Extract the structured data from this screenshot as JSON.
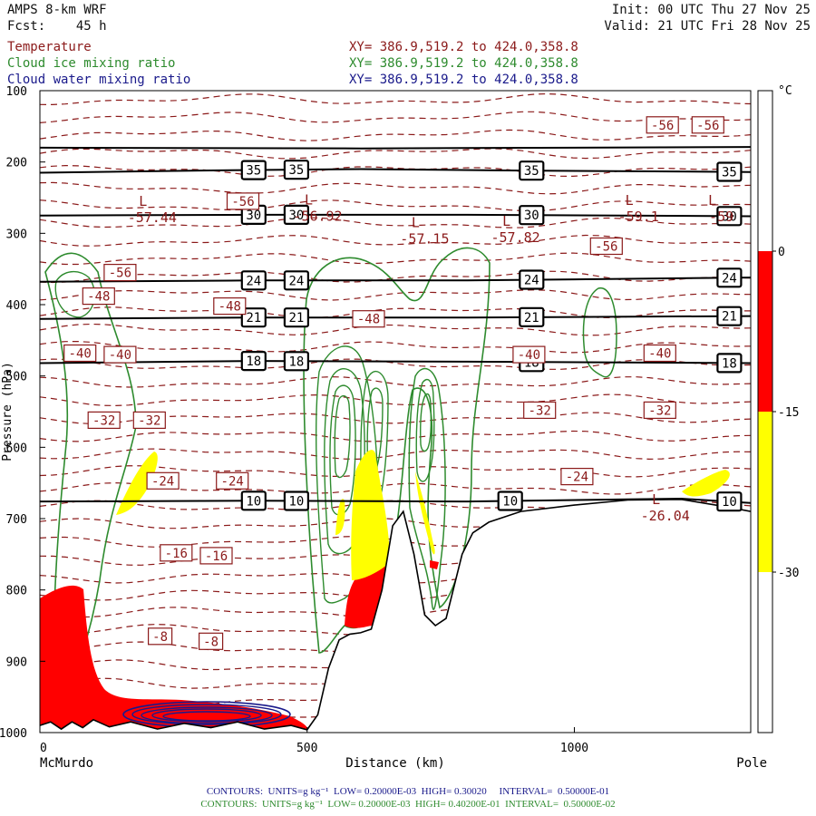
{
  "header": {
    "title": "AMPS 8-km WRF",
    "fcst_label": "Fcst:",
    "fcst_value": "45 h",
    "init": "Init: 00 UTC Thu 27 Nov 25",
    "valid": "Valid: 21 UTC Fri 28 Nov 25"
  },
  "fields": [
    {
      "name": "Temperature",
      "xy": "XY= 386.9,519.2 to 424.0,358.8",
      "color": "#8b1a1a"
    },
    {
      "name": "Cloud ice mixing ratio",
      "xy": "XY= 386.9,519.2 to 424.0,358.8",
      "color": "#2e8b2e"
    },
    {
      "name": "Cloud water mixing ratio",
      "xy": "XY= 386.9,519.2 to 424.0,358.8",
      "color": "#1a1a8b"
    }
  ],
  "footer": {
    "line1": "CONTOURS:  UNITS=g kg⁻¹  LOW= 0.20000E-03  HIGH= 0.30020     INTERVAL=  0.50000E-01",
    "line2": "CONTOURS:  UNITS=g kg⁻¹  LOW= 0.20000E-03  HIGH= 0.40200E-01  INTERVAL=  0.50000E-02",
    "line1_color": "#1a1a8b",
    "line2_color": "#2e8b2e"
  },
  "chart_data": {
    "type": "cross-section contour",
    "xlabel": "Distance (km)",
    "ylabel": "Pressure (hPa)",
    "xlim": [
      0,
      1330
    ],
    "ylim": [
      1000,
      100
    ],
    "x_ticks": [
      0,
      500,
      1000
    ],
    "x_end_labels": {
      "left": "McMurdo",
      "right": "Pole"
    },
    "y_ticks": [
      100,
      200,
      300,
      400,
      500,
      600,
      700,
      800,
      900,
      1000
    ],
    "colorbar": {
      "unit": "°C",
      "ticks": [
        0,
        -15,
        -30
      ],
      "bands": [
        {
          "from": 0,
          "to": -15,
          "color": "#ff0000"
        },
        {
          "from": -15,
          "to": -30,
          "color": "#ffff00"
        }
      ]
    },
    "isentropes": [
      {
        "label": "35",
        "points": [
          [
            0,
            215
          ],
          [
            300,
            212
          ],
          [
            600,
            210
          ],
          [
            900,
            212
          ],
          [
            1330,
            214
          ]
        ],
        "labels_at": [
          400,
          480,
          920,
          1290
        ]
      },
      {
        "label": "30",
        "points": [
          [
            0,
            275
          ],
          [
            400,
            274
          ],
          [
            800,
            274
          ],
          [
            1330,
            276
          ]
        ],
        "labels_at": [
          400,
          480,
          920,
          1290
        ]
      },
      {
        "label": "24",
        "points": [
          [
            0,
            368
          ],
          [
            400,
            366
          ],
          [
            800,
            366
          ],
          [
            1330,
            362
          ]
        ],
        "labels_at": [
          400,
          480,
          920,
          1290
        ]
      },
      {
        "label": "21",
        "points": [
          [
            0,
            420
          ],
          [
            400,
            418
          ],
          [
            800,
            418
          ],
          [
            1330,
            416
          ]
        ],
        "labels_at": [
          400,
          480,
          920,
          1290
        ]
      },
      {
        "label": "18",
        "points": [
          [
            0,
            482
          ],
          [
            400,
            479
          ],
          [
            800,
            480
          ],
          [
            1330,
            482
          ]
        ],
        "labels_at": [
          400,
          480,
          920,
          1290
        ]
      },
      {
        "label": "10",
        "points": [
          [
            0,
            676
          ],
          [
            400,
            675
          ],
          [
            800,
            676
          ],
          [
            1100,
            673
          ],
          [
            1200,
            672
          ],
          [
            1330,
            678
          ]
        ],
        "labels_at": [
          400,
          480,
          880,
          1290
        ]
      },
      {
        "label": "",
        "points": [
          [
            0,
            180
          ],
          [
            600,
            181
          ],
          [
            1330,
            179
          ]
        ],
        "labels_at": []
      }
    ],
    "temperature_labels": [
      {
        "x": 380,
        "p": 255,
        "value": "-56"
      },
      {
        "x": 150,
        "p": 355,
        "value": "-56"
      },
      {
        "x": 1060,
        "p": 318,
        "value": "-56"
      },
      {
        "x": 1165,
        "p": 148,
        "value": "-56"
      },
      {
        "x": 1250,
        "p": 148,
        "value": "-56"
      },
      {
        "x": 110,
        "p": 388,
        "value": "-48"
      },
      {
        "x": 355,
        "p": 402,
        "value": "-48"
      },
      {
        "x": 615,
        "p": 420,
        "value": "-48"
      },
      {
        "x": 75,
        "p": 468,
        "value": "-40"
      },
      {
        "x": 150,
        "p": 470,
        "value": "-40"
      },
      {
        "x": 915,
        "p": 470,
        "value": "-40"
      },
      {
        "x": 1160,
        "p": 468,
        "value": "-40"
      },
      {
        "x": 120,
        "p": 562,
        "value": "-32"
      },
      {
        "x": 205,
        "p": 562,
        "value": "-32"
      },
      {
        "x": 935,
        "p": 548,
        "value": "-32"
      },
      {
        "x": 1160,
        "p": 548,
        "value": "-32"
      },
      {
        "x": 230,
        "p": 647,
        "value": "-24"
      },
      {
        "x": 360,
        "p": 647,
        "value": "-24"
      },
      {
        "x": 1005,
        "p": 641,
        "value": "-24"
      },
      {
        "x": 255,
        "p": 748,
        "value": "-16"
      },
      {
        "x": 330,
        "p": 752,
        "value": "-16"
      },
      {
        "x": 225,
        "p": 865,
        "value": "-8"
      },
      {
        "x": 320,
        "p": 872,
        "value": "-8"
      }
    ],
    "lows": [
      {
        "x": 210,
        "p": 269,
        "value": "-57.44"
      },
      {
        "x": 520,
        "p": 267,
        "value": "-56.92"
      },
      {
        "x": 720,
        "p": 299,
        "value": "-57.15"
      },
      {
        "x": 890,
        "p": 297,
        "value": "-57.82"
      },
      {
        "x": 1120,
        "p": 268,
        "value": "-59.1"
      },
      {
        "x": 1275,
        "p": 268,
        "value": "-59"
      },
      {
        "x": 1170,
        "p": 687,
        "value": "-26.04"
      }
    ],
    "terrain": [
      [
        0,
        990
      ],
      [
        20,
        985
      ],
      [
        40,
        995
      ],
      [
        60,
        985
      ],
      [
        80,
        993
      ],
      [
        100,
        982
      ],
      [
        130,
        992
      ],
      [
        170,
        985
      ],
      [
        220,
        995
      ],
      [
        270,
        987
      ],
      [
        320,
        993
      ],
      [
        370,
        985
      ],
      [
        420,
        995
      ],
      [
        470,
        990
      ],
      [
        500,
        996
      ],
      [
        520,
        975
      ],
      [
        540,
        910
      ],
      [
        560,
        870
      ],
      [
        580,
        862
      ],
      [
        600,
        860
      ],
      [
        620,
        855
      ],
      [
        640,
        800
      ],
      [
        660,
        710
      ],
      [
        680,
        690
      ],
      [
        700,
        750
      ],
      [
        720,
        835
      ],
      [
        740,
        850
      ],
      [
        760,
        840
      ],
      [
        790,
        750
      ],
      [
        810,
        720
      ],
      [
        840,
        705
      ],
      [
        900,
        690
      ],
      [
        1000,
        681
      ],
      [
        1100,
        674
      ],
      [
        1200,
        673
      ],
      [
        1280,
        683
      ],
      [
        1330,
        690
      ]
    ]
  }
}
